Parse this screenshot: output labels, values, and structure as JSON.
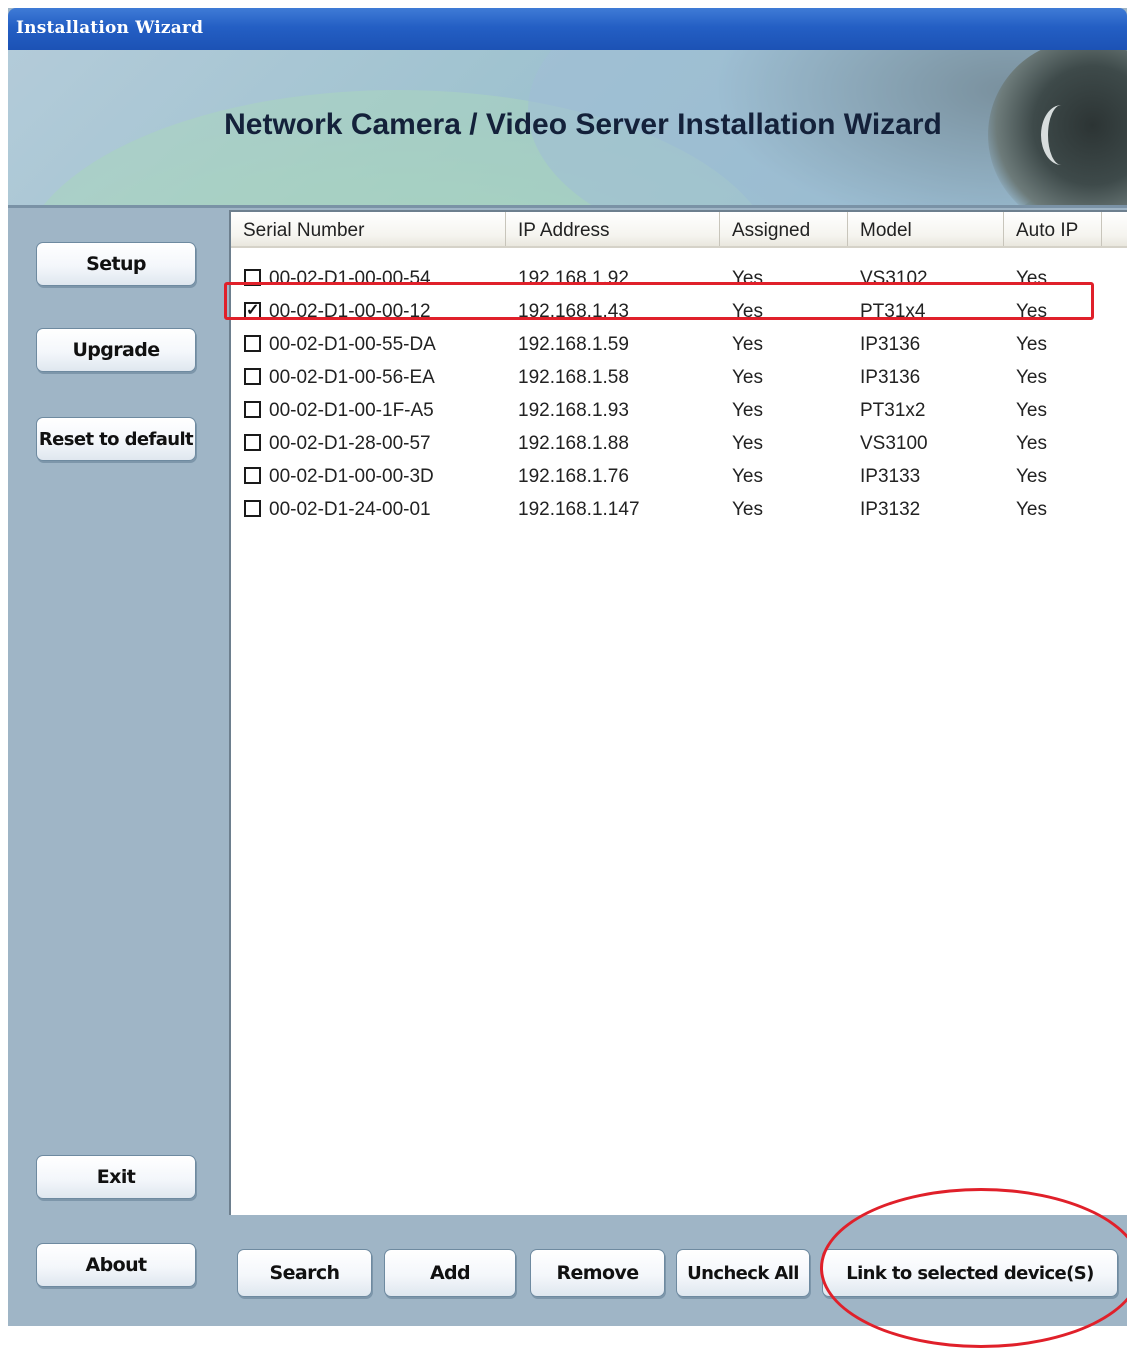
{
  "window": {
    "title": "Installation Wizard",
    "banner_title": "Network Camera / Video Server Installation Wizard"
  },
  "sidebar": {
    "setup": "Setup",
    "upgrade": "Upgrade",
    "reset": "Reset to default",
    "exit": "Exit",
    "about": "About"
  },
  "table": {
    "columns": [
      "Serial Number",
      "IP Address",
      "Assigned",
      "Model",
      "Auto IP"
    ],
    "rows": [
      {
        "checked": false,
        "serial": "00-02-D1-00-00-54",
        "ip": "192.168.1.92",
        "assigned": "Yes",
        "model": "VS3102",
        "auto_ip": "Yes"
      },
      {
        "checked": true,
        "serial": "00-02-D1-00-00-12",
        "ip": "192.168.1.43",
        "assigned": "Yes",
        "model": "PT31x4",
        "auto_ip": "Yes"
      },
      {
        "checked": false,
        "serial": "00-02-D1-00-55-DA",
        "ip": "192.168.1.59",
        "assigned": "Yes",
        "model": "IP3136",
        "auto_ip": "Yes"
      },
      {
        "checked": false,
        "serial": "00-02-D1-00-56-EA",
        "ip": "192.168.1.58",
        "assigned": "Yes",
        "model": "IP3136",
        "auto_ip": "Yes"
      },
      {
        "checked": false,
        "serial": "00-02-D1-00-1F-A5",
        "ip": "192.168.1.93",
        "assigned": "Yes",
        "model": "PT31x2",
        "auto_ip": "Yes"
      },
      {
        "checked": false,
        "serial": "00-02-D1-28-00-57",
        "ip": "192.168.1.88",
        "assigned": "Yes",
        "model": "VS3100",
        "auto_ip": "Yes"
      },
      {
        "checked": false,
        "serial": "00-02-D1-00-00-3D",
        "ip": "192.168.1.76",
        "assigned": "Yes",
        "model": "IP3133",
        "auto_ip": "Yes"
      },
      {
        "checked": false,
        "serial": "00-02-D1-24-00-01",
        "ip": "192.168.1.147",
        "assigned": "Yes",
        "model": "IP3132",
        "auto_ip": "Yes"
      }
    ]
  },
  "bottom": {
    "search": "Search",
    "add": "Add",
    "remove": "Remove",
    "uncheck_all": "Uncheck All",
    "link": "Link to selected device(S)"
  },
  "colors": {
    "highlight": "#e0202a",
    "titlebar": "#245fc4"
  }
}
